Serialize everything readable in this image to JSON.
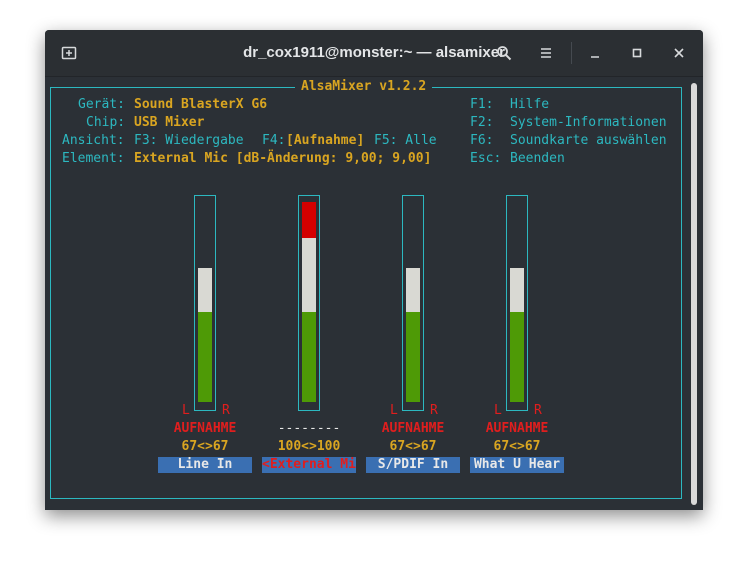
{
  "window": {
    "title": "dr_cox1911@monster:~ — alsamixer"
  },
  "icons": {
    "new_tab": "new-tab-icon",
    "search": "search-icon",
    "menu": "hamburger-menu-icon",
    "minimize": "minimize-icon",
    "maximize": "maximize-icon",
    "close": "close-icon"
  },
  "mixer": {
    "title": "AlsaMixer v1.2.2",
    "info": {
      "device_label": "Gerät:",
      "device_value": "Sound BlasterX G6",
      "chip_label": "Chip:",
      "chip_value": "USB Mixer",
      "view_label": "Ansicht:",
      "view_f3": "F3: Wiedergabe",
      "view_f4_key": "F4:",
      "view_f4_active": "[Aufnahme]",
      "view_f5": "F5: Alle",
      "element_label": "Element:",
      "element_value": "External Mic [dB-Änderung: 9,00; 9,00]"
    },
    "keys": [
      {
        "key": "F1:",
        "desc": "Hilfe"
      },
      {
        "key": "F2:",
        "desc": "System-Informationen"
      },
      {
        "key": "F6:",
        "desc": "Soundkarte auswählen"
      },
      {
        "key": "Esc:",
        "desc": "Beenden"
      }
    ],
    "channels": [
      {
        "name": "Line In",
        "level": 67,
        "level_text": "67<>67",
        "capture_text": "AUFNAHME",
        "l": "L",
        "r": "R",
        "selected": false
      },
      {
        "name": "<External Mic>",
        "level": 100,
        "level_text": "100<>100",
        "capture_text": "--------",
        "l": "",
        "r": "",
        "selected": true
      },
      {
        "name": "S/PDIF In",
        "level": 67,
        "level_text": "67<>67",
        "capture_text": "AUFNAHME",
        "l": "L",
        "r": "R",
        "selected": false
      },
      {
        "name": "What U Hear",
        "level": 67,
        "level_text": "67<>67",
        "capture_text": "AUFNAHME",
        "l": "L",
        "r": "R",
        "selected": false
      }
    ],
    "colors": {
      "green": "#4e9a06",
      "white": "#d9d9d3",
      "red": "#d40000",
      "cyan": "#2cb8c0",
      "yellow": "#d9a521"
    }
  }
}
